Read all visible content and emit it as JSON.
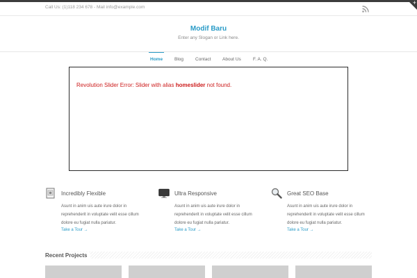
{
  "topbar": {
    "contact": "Call Us: (1)118 234 678 - Mail info@example.com",
    "rss_icon": "rss-icon"
  },
  "header": {
    "title": "Modif Baru",
    "slogan": "Enter any Slogan or Link here."
  },
  "nav": {
    "items": [
      {
        "label": "Home",
        "active": true
      },
      {
        "label": "Blog",
        "active": false
      },
      {
        "label": "Contact",
        "active": false
      },
      {
        "label": "About Us",
        "active": false
      },
      {
        "label": "F. A. Q.",
        "active": false
      }
    ]
  },
  "slider": {
    "error_prefix": "Revolution Slider Error: Slider with alias ",
    "alias": "homeslider",
    "error_suffix": " not found."
  },
  "features": [
    {
      "icon": "document-icon",
      "title": "Incredibly Flexible",
      "text": "Asunt in anim uis aute irure dolor in reprehenderit in voluptate velit esse cillum dolore eu fugiat nulla pariatur.",
      "link": "Take a Tour →"
    },
    {
      "icon": "monitor-icon",
      "title": "Ultra Responsive",
      "text": "Asunt in anim uis aute irure dolor in reprehenderit in voluptate velit esse cillum dolore eu fugiat nulla pariatur.",
      "link": "Take a Tour →"
    },
    {
      "icon": "magnifier-icon",
      "title": "Great SEO Base",
      "text": "Asunt in anim uis aute irure dolor in reprehenderit in voluptate velit esse cillum dolore eu fugiat nulla pariatur.",
      "link": "Take a Tour →"
    }
  ],
  "recent": {
    "title": "Recent Projects"
  },
  "colors": {
    "accent": "#2a9bc7",
    "error": "#cc1b1b"
  }
}
